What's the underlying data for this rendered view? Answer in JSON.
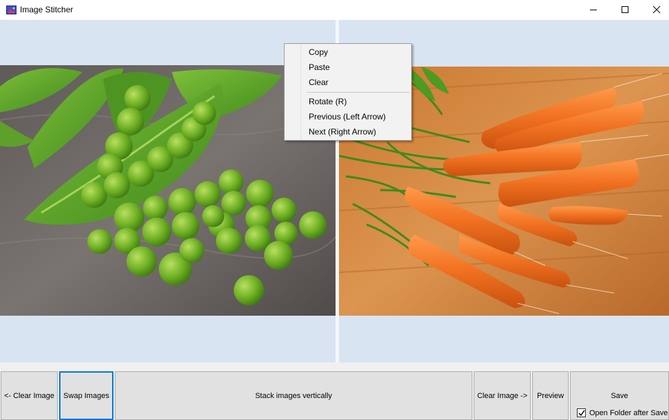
{
  "window": {
    "title": "Image Stitcher",
    "icon": "image-stitcher-app-icon"
  },
  "images": {
    "left": "peas-photo",
    "right": "carrots-photo"
  },
  "context_menu": {
    "items": [
      "Copy",
      "Paste",
      "Clear",
      "Rotate (R)",
      "Previous (Left Arrow)",
      "Next (Right Arrow)"
    ]
  },
  "buttons": {
    "clear_left": "<- Clear Image",
    "swap": "Swap Images",
    "stack": "Stack images vertically",
    "clear_right": "Clear Image ->",
    "preview": "Preview",
    "save": "Save"
  },
  "options": {
    "open_folder_label": "Open Folder after Save",
    "open_folder_checked": true
  },
  "colors": {
    "pane_background": "#d9e4f2",
    "focus_border": "#0078d7"
  }
}
